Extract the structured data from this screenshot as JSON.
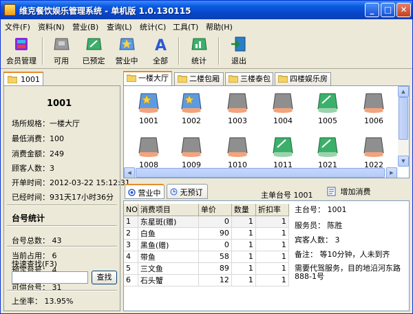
{
  "window": {
    "title": "维克餐饮娱乐管理系统 - 单机版 1.0.130115",
    "min": "_",
    "max": "□",
    "close": "✕"
  },
  "menu": [
    "文件(F)",
    "资料(N)",
    "营业(B)",
    "查询(L)",
    "统计(C)",
    "工具(T)",
    "帮助(H)"
  ],
  "toolbar": {
    "member": "会员管理",
    "available": "可用",
    "reserved": "已预定",
    "in_business": "营业中",
    "all": "全部",
    "stats": "统计",
    "exit": "退出"
  },
  "left": {
    "tab": "1001",
    "table_no": "1001",
    "area": "场所规格：一楼大厅",
    "min_spend": "最低消费：100",
    "spent": "消费金额：249",
    "guests": "顾客人数：3",
    "open_time": "开单时间：2012-03-22 15:12:31",
    "elapsed": "已经时间：931天17小时36分",
    "stats_title": "台号统计",
    "total": "台号总数：   43",
    "occupied": "当前占用：   6",
    "reserved": "预定台号：   4",
    "available": "可供台号：   31",
    "quick_search": "快速查找(F3)",
    "search_value": "",
    "search_button": "查找",
    "rate": "上坐率：     13.95%"
  },
  "tabs": [
    "一楼大厅",
    "二楼包厢",
    "三楼泰包",
    "四楼娱乐房"
  ],
  "tables": [
    {
      "no": "1001",
      "status": "busy"
    },
    {
      "no": "1002",
      "status": "busy"
    },
    {
      "no": "1003",
      "status": "free"
    },
    {
      "no": "1004",
      "status": "free"
    },
    {
      "no": "1005",
      "status": "reserved"
    },
    {
      "no": "1006",
      "status": "free"
    },
    {
      "no": "1008",
      "status": "free"
    },
    {
      "no": "1009",
      "status": "free"
    },
    {
      "no": "1010",
      "status": "free"
    },
    {
      "no": "1011",
      "status": "reserved"
    },
    {
      "no": "1021",
      "status": "reserved"
    },
    {
      "no": "1022",
      "status": "free"
    }
  ],
  "order": {
    "tab_business": "营业中",
    "tab_unreserved": "无预订",
    "main_table": "主单台号  1001",
    "add_button": "增加消费",
    "headers": [
      "NO",
      "消费项目",
      "单价",
      "数量",
      "折扣率"
    ],
    "items": [
      {
        "no": "1",
        "name": "东星斑(赠)",
        "price": "0",
        "qty": "1",
        "rate": "1"
      },
      {
        "no": "2",
        "name": "白鱼",
        "price": "90",
        "qty": "1",
        "rate": "1"
      },
      {
        "no": "3",
        "name": "黑鱼(赠)",
        "price": "0",
        "qty": "1",
        "rate": "1"
      },
      {
        "no": "4",
        "name": "带鱼",
        "price": "58",
        "qty": "1",
        "rate": "1"
      },
      {
        "no": "5",
        "name": "三文鱼",
        "price": "89",
        "qty": "1",
        "rate": "1"
      },
      {
        "no": "6",
        "name": "石头蟹",
        "price": "12",
        "qty": "1",
        "rate": "1"
      }
    ],
    "info_table": "主台号：  1001",
    "info_waiter": "服务员：  陈胜",
    "info_guests": "宾客人数：  3",
    "info_note": "备注：  等10分钟，人未到齐",
    "info_note2": "需要代驾服务，目的地沿河东路",
    "info_note3": "888-1号"
  },
  "colors": {
    "busy": "#f2a47c",
    "free": "#9a9a9a",
    "reserved": "#3cb06a",
    "accent": "#e68b2c"
  }
}
